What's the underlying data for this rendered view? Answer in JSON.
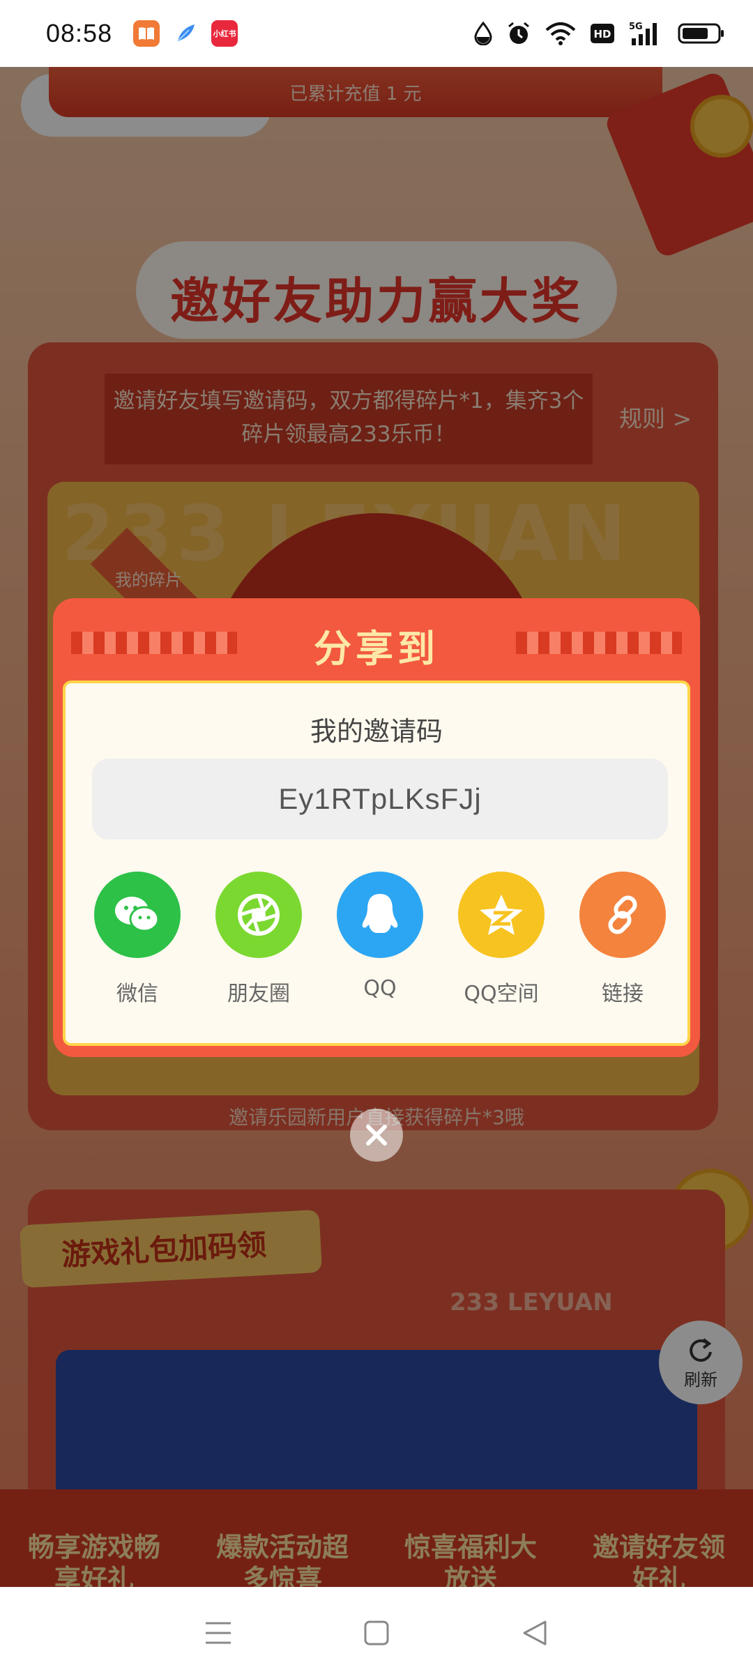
{
  "status_bar": {
    "time": "08:58",
    "apps": [
      {
        "name": "reader-app-icon",
        "color": "#f07a36"
      },
      {
        "name": "feather-app-icon",
        "color": "#3b8cf0"
      },
      {
        "name": "xiaohongshu-app-icon",
        "color": "#e8283c",
        "label": "小红书"
      }
    ],
    "hd": "HD",
    "network": "5G"
  },
  "page": {
    "recharge_text": "已累计充值 1 元",
    "invite_title": "邀好友助力赢大奖",
    "rule_text": "邀请好友填写邀请码，双方都得碎片*1，集齐3个碎片领最高233乐币！",
    "rule_link": "规则 >",
    "fragment_bg_text": "233 LEYUAN",
    "my_fragment": "我的碎片",
    "invite_hint": "邀请乐园新用户直接获得碎片*3哦",
    "gift_title": "游戏礼包加码领",
    "brand": "233 LEYUAN",
    "refresh": "刷新",
    "bottom_items": [
      "畅享游戏畅享好礼",
      "爆款活动超多惊喜",
      "惊喜福利大放送",
      "邀请好友领好礼"
    ]
  },
  "dialog": {
    "title": "分享到",
    "code_label": "我的邀请码",
    "code_value": "Ey1RTpLKsFJj",
    "share_options": [
      {
        "label": "微信",
        "color": "#2dc148",
        "icon": "wechat-icon"
      },
      {
        "label": "朋友圈",
        "color": "#7bd830",
        "icon": "moments-icon"
      },
      {
        "label": "QQ",
        "color": "#2ca6f2",
        "icon": "qq-icon"
      },
      {
        "label": "QQ空间",
        "color": "#f7c320",
        "icon": "qzone-icon"
      },
      {
        "label": "链接",
        "color": "#f4833d",
        "icon": "link-icon"
      }
    ]
  },
  "colors": {
    "dialog_bg": "#f2593f",
    "dialog_title": "#fde8a8",
    "inner_border": "#ffd54a"
  }
}
